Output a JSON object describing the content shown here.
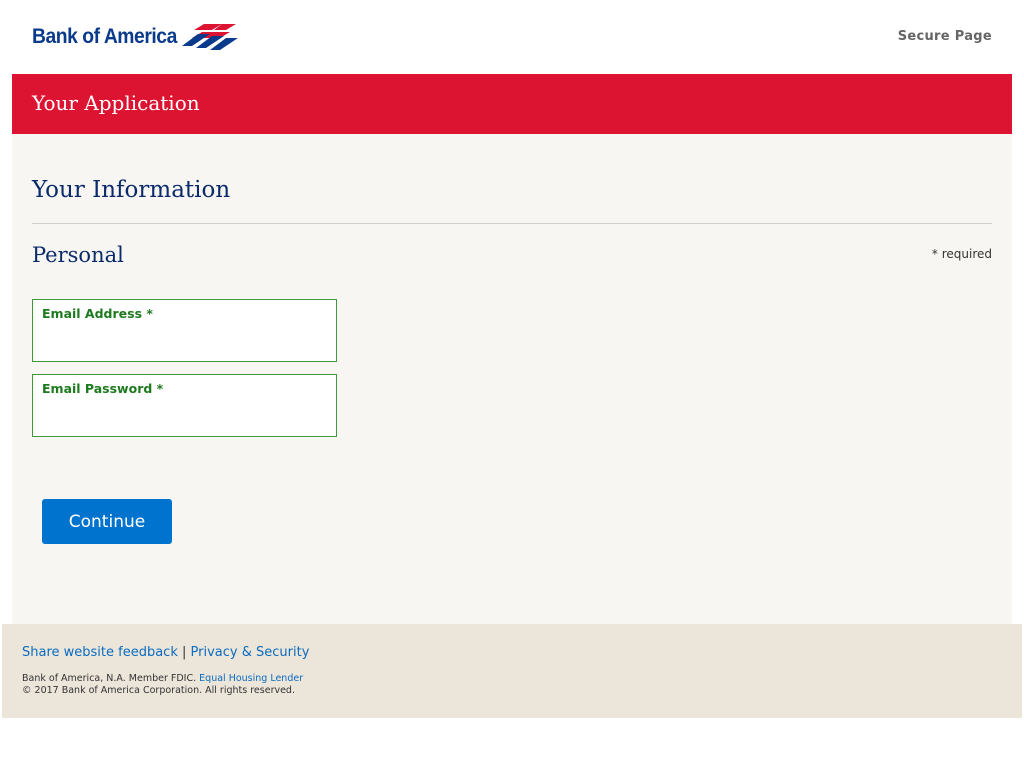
{
  "header": {
    "logo_text": "Bank of America",
    "secure_label": "Secure Page"
  },
  "banner": {
    "title": "Your Application"
  },
  "main": {
    "section_title": "Your Information",
    "subsection_title": "Personal",
    "required_note": "* required",
    "fields": [
      {
        "label": "Email Address *",
        "value": "",
        "placeholder": ""
      },
      {
        "label": "Email Password *",
        "value": "",
        "placeholder": ""
      }
    ],
    "continue_label": "Continue"
  },
  "footer": {
    "feedback_link": "Share website feedback",
    "separator": "|",
    "privacy_link": "Privacy & Security",
    "legal_line1": "Bank of America, N.A. Member FDIC.",
    "equal_housing_link": "Equal Housing Lender",
    "legal_line2": "© 2017 Bank of America Corporation. All rights reserved."
  },
  "colors": {
    "brand_blue": "#0a3a8c",
    "brand_red": "#dc1431",
    "button_blue": "#0073cf",
    "field_green": "#3c9a3c",
    "link_blue": "#0a6cc1"
  },
  "icons": {
    "logo_flag": "flag-logo-icon"
  }
}
